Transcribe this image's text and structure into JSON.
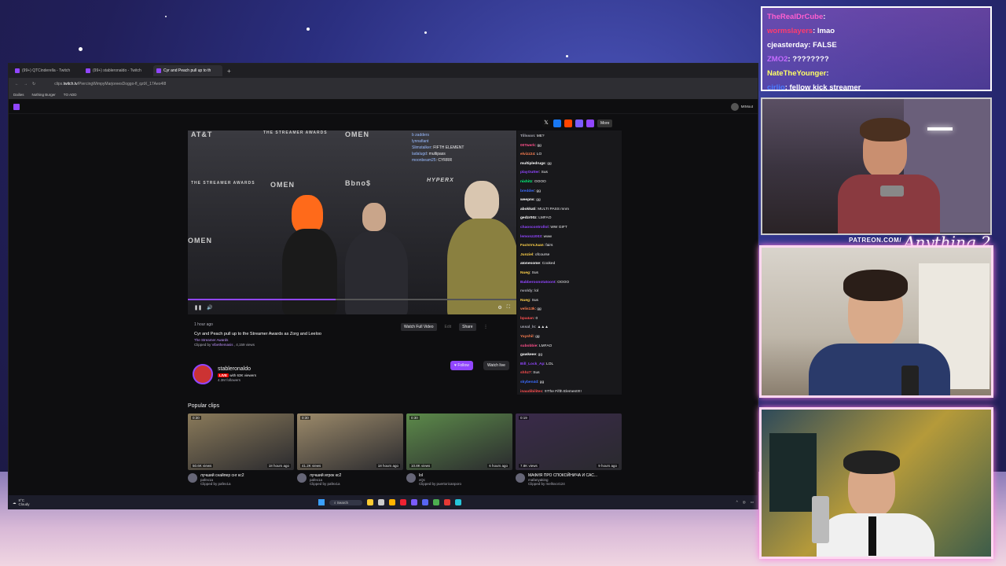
{
  "browser": {
    "tabs": [
      {
        "label": "(99+) QTCinderella - Twitch"
      },
      {
        "label": "(99+) stableronaldo - Twitch"
      },
      {
        "label": "Cyr and Peach pull up to th"
      }
    ],
    "url_prefix": "clips.",
    "url_host": "twitch.tv",
    "url_path": "/PiercingWimpyMarjoreesDoggo-fl_qztX_17Aeo4l8",
    "bookmarks": [
      "Dailies",
      "Nothing Burger",
      "TO ADD"
    ],
    "user": "MrMout"
  },
  "share": {
    "more_label": "More"
  },
  "video_overlay_chat": [
    {
      "name": "b zadders",
      "msg": ""
    },
    {
      "name": "lynnafiant",
      "msg": ""
    },
    {
      "name": "Slimstalker",
      "msg": ": FIFTH ELEMENT"
    },
    {
      "name": "ladalugd",
      "msg": ": multipass"
    },
    {
      "name": "moonbeam25",
      "msg": ": CYRRR"
    }
  ],
  "video": {
    "sponsors": [
      "AT&T",
      "OMEN",
      "THE STREAMER AWARDS",
      "Bbno$",
      "HYPERX"
    ],
    "progress": 0.45
  },
  "clip": {
    "ago": "1 hour ago",
    "title": "Cyr and Peach pull up to the Streamer Awards as Zorg and Leeloo",
    "game": "The Streamer Awards",
    "clipped_by_prefix": "Clipped by ",
    "clipped_by": "Vibethemasis",
    "views": " , 4,159 views",
    "watch_full": "Watch Full Video",
    "edit": "Edit",
    "share": "Share"
  },
  "channel": {
    "name": "stableronaldo",
    "live_badge": "LIVE",
    "viewers": "with 63K viewers",
    "followers": "4.3M followers",
    "follow": "Follow",
    "watch_live": "Watch live"
  },
  "chat": [
    {
      "name": "Tillsson",
      "msg": ": ME?",
      "color": "#adadb8"
    },
    {
      "name": "00Twerk",
      "msg": ": gg",
      "color": "#ff4f8b"
    },
    {
      "name": "elvizz24",
      "msg": ": LO",
      "color": "#ff7f50"
    },
    {
      "name": "multipledrugs",
      "msg": ": gg",
      "color": "#ffffff"
    },
    {
      "name": "playOutter",
      "msg": ": Sus",
      "color": "#9146ff"
    },
    {
      "name": "nixhitz",
      "msg": ": OOOO",
      "color": "#00ff7f"
    },
    {
      "name": "bredder",
      "msg": ": gg",
      "color": "#3b6cff"
    },
    {
      "name": "weepns",
      "msg": ": gg",
      "color": "#ffffff"
    },
    {
      "name": "abokkati",
      "msg": ": MULTI PASS mnm",
      "color": "#ffffff"
    },
    {
      "name": "gedzr00z",
      "msg": ": LMFAO",
      "color": "#ffffff"
    },
    {
      "name": "chaoscontrollol",
      "msg": ": WW GIFT",
      "color": "#9146ff"
    },
    {
      "name": "lemonzz003",
      "msg": ": www",
      "color": "#9146ff"
    },
    {
      "name": "FactsVsJuan",
      "msg": ": fairs",
      "color": "#ffd24a"
    },
    {
      "name": "Junziel",
      "msg": ": ofcourse",
      "color": "#ffd24a"
    },
    {
      "name": "aIonesome",
      "msg": ": Cooked",
      "color": "#ffffff"
    },
    {
      "name": "Nueg",
      "msg": ": Sus",
      "color": "#ffd24a"
    },
    {
      "name": "Babberoonotatoont",
      "msg": ": OOOO",
      "color": "#9146ff"
    },
    {
      "name": "nvoldy",
      "msg": ": lol",
      "color": "#adadb8"
    },
    {
      "name": "Nueg",
      "msg": ": Sus",
      "color": "#ffd24a"
    },
    {
      "name": "velis13k",
      "msg": ": gg",
      "color": "#ff7f50"
    },
    {
      "name": "bpa4an",
      "msg": ": 0",
      "color": "#ff4f4f"
    },
    {
      "name": "ussal_ls",
      "msg": ": ▲▲▲",
      "color": "#adadb8"
    },
    {
      "name": "Yayshil",
      "msg": ": gg",
      "color": "#ff7f50"
    },
    {
      "name": "subobbie",
      "msg": ": LMFAO",
      "color": "#ff4f8b"
    },
    {
      "name": "gawkeee",
      "msg": ": gg",
      "color": "#ffffff"
    },
    {
      "name": "Bill_Lock_Ap",
      "msg": ": LOL",
      "color": "#9146ff"
    },
    {
      "name": "shhz7",
      "msg": ": Sus",
      "color": "#ff4f4f"
    },
    {
      "name": "skyben4d",
      "msg": ": gg",
      "color": "#3b6cff"
    },
    {
      "name": "inaudibilites",
      "msg": ": !!!The Fifth Element!!!!",
      "color": "#ff4f4f"
    }
  ],
  "popular": {
    "heading": "Popular clips",
    "clips": [
      {
        "duration": "0:30",
        "views": "50.6K views",
        "age": "18 hours ago",
        "title": "лучший снайпер снг кс2",
        "channel": "pafex1a",
        "clipped": "Clipped by pafex1a",
        "thumb": "#8a7a5a"
      },
      {
        "duration": "0:30",
        "views": "41.2K views",
        "age": "18 hours ago",
        "title": "лучший игрок кс2",
        "channel": "pafex1a",
        "clipped": "Clipped by pafex1a",
        "thumb": "#9c8a6a"
      },
      {
        "duration": "0:30",
        "views": "10.8K views",
        "age": "6 hours ago",
        "title": "lol",
        "channel": "xQc",
        "clipped": "Clipped by puertoricanporo",
        "thumb": "#5c8a4a"
      },
      {
        "duration": "0:19",
        "views": "7.8K views",
        "age": "9 hours ago",
        "title": "МАФИЯ ПРО СПОКОЙНИЧА И САС...",
        "channel": "mafanyaking",
        "clipped": "Clipped by mellsvor124",
        "thumb": "#3a2a4a"
      }
    ]
  },
  "taskbar": {
    "temp": "8°C",
    "weather": "Cloudy",
    "search": "Search"
  },
  "overlay_chat": [
    {
      "name": "TheRealDrCube",
      "msg": ":",
      "color": "#ff5fd0"
    },
    {
      "name": "wormslayers",
      "msg": ": lmao",
      "color": "#ff3c6e"
    },
    {
      "name": "cjeasterday",
      "msg": ": FALSE",
      "color": "#ffffff"
    },
    {
      "name": "ZMO2",
      "msg": ": ????????",
      "color": "#c56bff"
    },
    {
      "name": "NateTheYounger",
      "msg": ":",
      "color": "#ffff66"
    },
    {
      "name": "cirlio",
      "msg": ": fellow kick streamer",
      "color": "#4a7bff"
    }
  ],
  "patreon": "PATREON.COM/",
  "signature": "Anything 2"
}
